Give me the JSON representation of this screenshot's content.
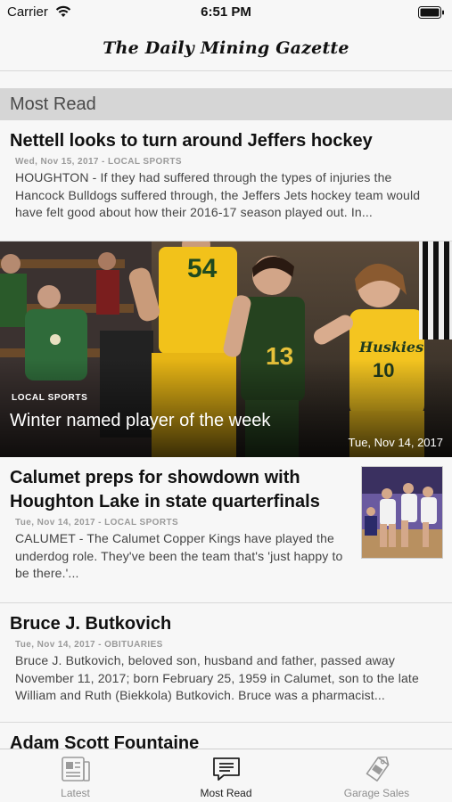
{
  "status_bar": {
    "carrier": "Carrier",
    "time": "6:51 PM"
  },
  "masthead": {
    "title": "The Daily Mining Gazette"
  },
  "section": {
    "title": "Most Read"
  },
  "articles": [
    {
      "title": "Nettell looks to turn around Jeffers hockey",
      "meta": "Wed, Nov 15, 2017 - LOCAL SPORTS",
      "excerpt": "HOUGHTON - If they had suffered through the types of injuries the Hancock Bulldogs suffered through, the Jeffers Jets hockey team would have felt good about how their 2016-17 season played out. In..."
    },
    {
      "title": "Calumet preps for showdown with Houghton Lake in state quarterfinals",
      "meta": "Tue, Nov 14, 2017 - LOCAL SPORTS",
      "excerpt": "CALUMET - The Calumet Copper Kings have played the underdog role. They've been the team that's 'just happy to be there.'..."
    },
    {
      "title": "Bruce J. Butkovich",
      "meta": "Tue, Nov 14, 2017 - OBITUARIES",
      "excerpt": "Bruce J. Butkovich, beloved son, husband and father, passed away November 11, 2017; born February 25, 1959 in Calumet, son to the late William and Ruth (Biekkola) Butkovich. Bruce was a pharmacist..."
    },
    {
      "title": "Adam Scott Fountaine"
    }
  ],
  "featured": {
    "category": "LOCAL SPORTS",
    "title": "Winter named player of the week",
    "date": "Tue, Nov 14, 2017",
    "image_jersey_numbers": [
      "54",
      "13",
      "10"
    ],
    "image_jersey_text": "Huskies"
  },
  "tabs": [
    {
      "label": "Latest",
      "icon": "newspaper-icon",
      "active": false
    },
    {
      "label": "Most Read",
      "icon": "speech-bubble-icon",
      "active": true
    },
    {
      "label": "Garage Sales",
      "icon": "price-tag-icon",
      "active": false
    }
  ],
  "colors": {
    "background": "#f7f7f7",
    "section_header": "#d6d6d6",
    "tab_active": "#222222",
    "tab_inactive": "#8e8e8e"
  }
}
